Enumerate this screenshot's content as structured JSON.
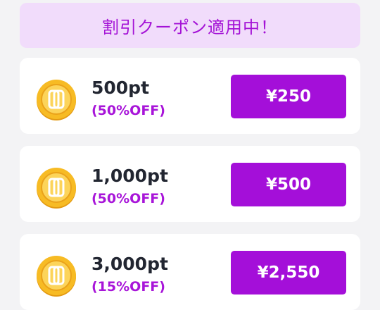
{
  "banner": {
    "text": "割引クーポン適用中！"
  },
  "colors": {
    "accent": "#a40fd9",
    "banner_bg": "#f1dcfb",
    "coin": "#f5b41e"
  },
  "packages": [
    {
      "points": "500pt",
      "discount": "(50%OFF)",
      "price": "¥250",
      "icon": "coin-icon"
    },
    {
      "points": "1,000pt",
      "discount": "(50%OFF)",
      "price": "¥500",
      "icon": "coin-icon"
    },
    {
      "points": "3,000pt",
      "discount": "(15%OFF)",
      "price": "¥2,550",
      "icon": "coin-icon"
    }
  ]
}
